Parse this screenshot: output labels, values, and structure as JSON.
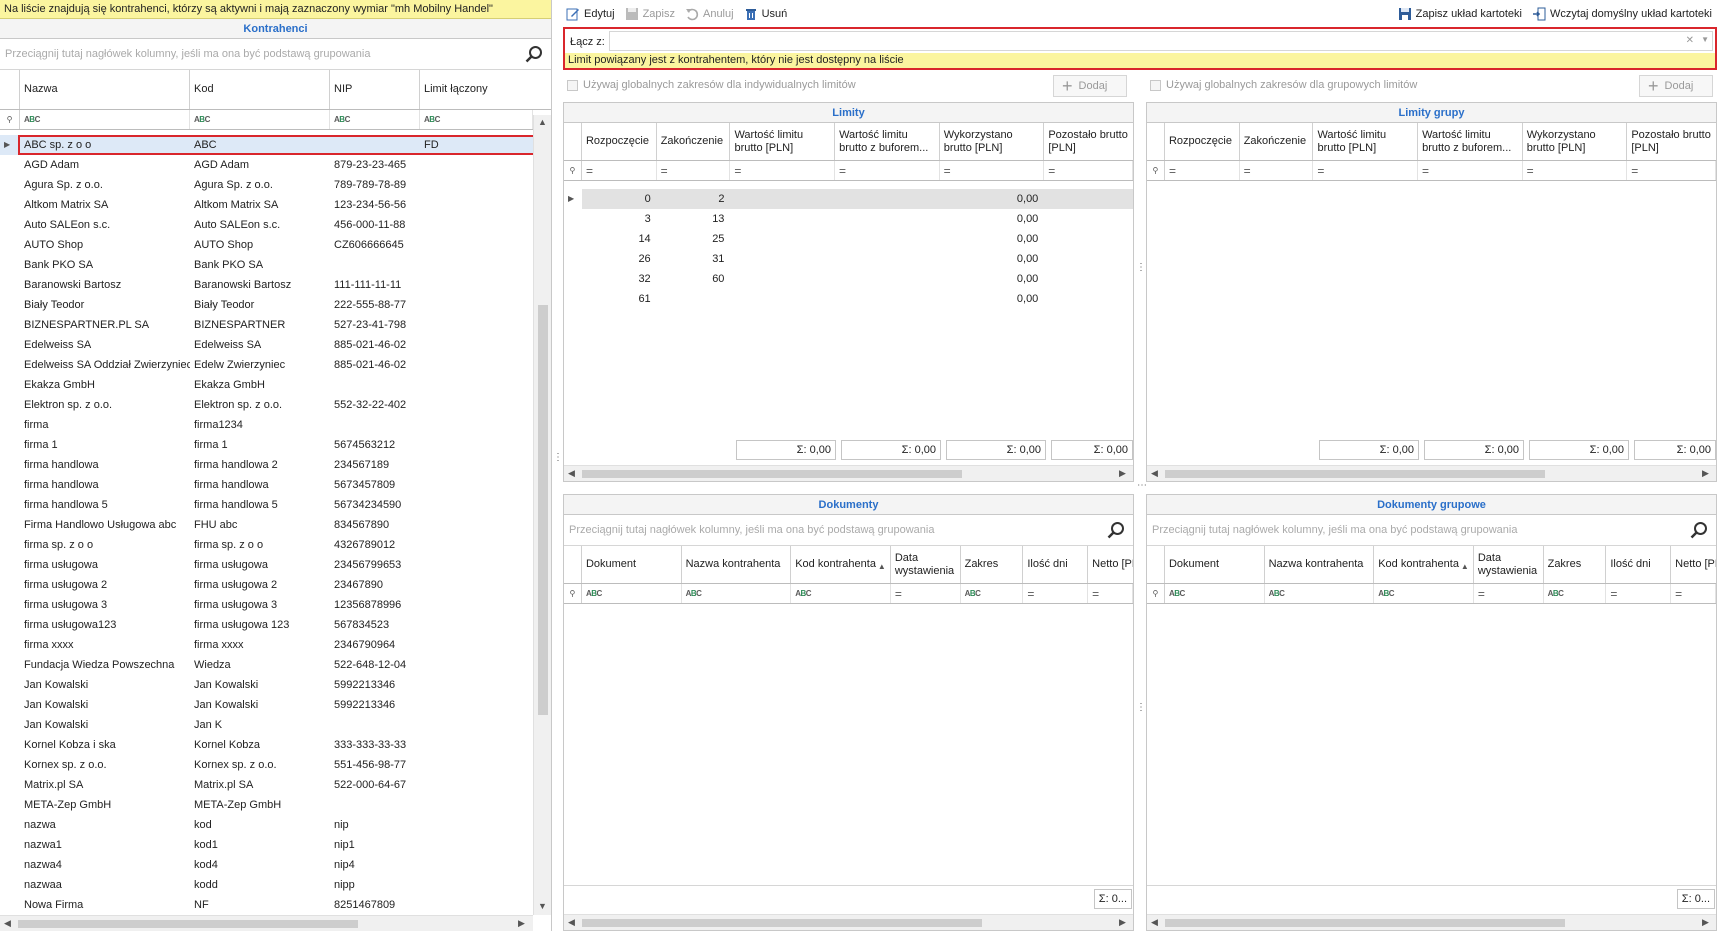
{
  "left": {
    "notice": "Na liście znajdują się kontrahenci, którzy są aktywni i mają zaznaczony wymiar \"mh Mobilny Handel\"",
    "title": "Kontrahenci",
    "group_placeholder": "Przeciągnij tutaj nagłówek kolumny, jeśli ma ona być podstawą grupowania",
    "columns": [
      "Nazwa",
      "Kod",
      "NIP",
      "Limit łączony"
    ],
    "rows": [
      [
        "ABC sp. z o o",
        "ABC",
        "",
        "FD"
      ],
      [
        "AGD Adam",
        "AGD Adam",
        "879-23-23-465",
        ""
      ],
      [
        "Agura Sp. z o.o.",
        "Agura Sp. z o.o.",
        "789-789-78-89",
        ""
      ],
      [
        "Altkom Matrix SA",
        "Altkom Matrix SA",
        "123-234-56-56",
        ""
      ],
      [
        "Auto SALEon s.c.",
        "Auto SALEon s.c.",
        "456-000-11-88",
        ""
      ],
      [
        "AUTO Shop",
        "AUTO Shop",
        "CZ606666645",
        ""
      ],
      [
        "Bank PKO SA",
        "Bank PKO SA",
        "",
        ""
      ],
      [
        "Baranowski Bartosz",
        "Baranowski Bartosz",
        "111-111-11-11",
        ""
      ],
      [
        "Biały Teodor",
        "Biały Teodor",
        "222-555-88-77",
        ""
      ],
      [
        "BIZNESPARTNER.PL SA",
        "BIZNESPARTNER",
        "527-23-41-798",
        ""
      ],
      [
        "Edelweiss SA",
        "Edelweiss SA",
        "885-021-46-02",
        ""
      ],
      [
        "Edelweiss SA Oddział Zwierzyniec",
        "Edelw Zwierzyniec",
        "885-021-46-02",
        ""
      ],
      [
        "Ekakza GmbH",
        "Ekakza GmbH",
        "",
        ""
      ],
      [
        "Elektron sp. z o.o.",
        "Elektron sp. z o.o.",
        "552-32-22-402",
        ""
      ],
      [
        "firma",
        "firma1234",
        "",
        ""
      ],
      [
        "firma 1",
        "firma 1",
        "5674563212",
        ""
      ],
      [
        "firma handlowa",
        "firma handlowa 2",
        "234567189",
        ""
      ],
      [
        "firma handlowa",
        "firma handlowa",
        "5673457809",
        ""
      ],
      [
        "firma handlowa 5",
        "firma handlowa 5",
        "56734234590",
        ""
      ],
      [
        "Firma Handlowo Usługowa abc",
        "FHU abc",
        "834567890",
        ""
      ],
      [
        "firma sp. z o o",
        "firma sp. z o o",
        "4326789012",
        ""
      ],
      [
        "firma usługowa",
        "firma usługowa",
        "23456799653",
        ""
      ],
      [
        "firma usługowa 2",
        "firma usługowa 2",
        "23467890",
        ""
      ],
      [
        "firma usługowa 3",
        "firma usługowa 3",
        "12356878996",
        ""
      ],
      [
        "firma usługowa123",
        "firma usługowa 123",
        "567834523",
        ""
      ],
      [
        "firma xxxx",
        "firma xxxx",
        "2346790964",
        ""
      ],
      [
        "Fundacja Wiedza Powszechna",
        "Wiedza",
        "522-648-12-04",
        ""
      ],
      [
        "Jan Kowalski",
        "Jan Kowalski",
        "5992213346",
        ""
      ],
      [
        "Jan Kowalski",
        "Jan Kowalski",
        "5992213346",
        ""
      ],
      [
        "Jan Kowalski",
        "Jan K",
        "",
        ""
      ],
      [
        "Kornel Kobza i ska",
        "Kornel Kobza",
        "333-333-33-33",
        ""
      ],
      [
        "Kornex sp. z o.o.",
        "Kornex sp. z o.o.",
        "551-456-98-77",
        ""
      ],
      [
        "Matrix.pl SA",
        "Matrix.pl SA",
        "522-000-64-67",
        ""
      ],
      [
        "META-Zep GmbH",
        "META-Zep GmbH",
        "",
        ""
      ],
      [
        "nazwa",
        "kod",
        "nip",
        ""
      ],
      [
        "nazwa1",
        "kod1",
        "nip1",
        ""
      ],
      [
        "nazwa4",
        "kod4",
        "nip4",
        ""
      ],
      [
        "nazwaa",
        "kodd",
        "nipp",
        ""
      ],
      [
        "Nowa Firma",
        "NF",
        "8251467809",
        ""
      ]
    ]
  },
  "toolbar": {
    "edit": "Edytuj",
    "save": "Zapisz",
    "cancel": "Anuluj",
    "delete": "Usuń",
    "save_layout": "Zapisz układ kartoteki",
    "load_layout": "Wczytaj domyślny układ kartoteki"
  },
  "link": {
    "label": "Łącz z:",
    "value": "",
    "warning": "Limit powiązany jest z kontrahentem, który nie jest dostępny na liście"
  },
  "limits": {
    "use_global_label": "Używaj globalnych zakresów dla indywidualnych limitów",
    "add_label": "Dodaj",
    "title": "Limity",
    "columns": [
      "Rozpoczęcie",
      "Zakończenie",
      "Wartość limitu brutto [PLN]",
      "Wartość limitu brutto z buforem...",
      "Wykorzystano brutto [PLN]",
      "Pozostało brutto [PLN]"
    ],
    "rows": [
      [
        "0",
        "2",
        "",
        "",
        "0,00",
        ""
      ],
      [
        "3",
        "13",
        "",
        "",
        "0,00",
        ""
      ],
      [
        "14",
        "25",
        "",
        "",
        "0,00",
        ""
      ],
      [
        "26",
        "31",
        "",
        "",
        "0,00",
        ""
      ],
      [
        "32",
        "60",
        "",
        "",
        "0,00",
        ""
      ],
      [
        "61",
        "",
        "",
        "",
        "0,00",
        ""
      ]
    ],
    "sums": [
      "Σ: 0,00",
      "Σ: 0,00",
      "Σ: 0,00",
      "Σ: 0,00"
    ]
  },
  "group_limits": {
    "use_global_label": "Używaj globalnych zakresów dla grupowych limitów",
    "add_label": "Dodaj",
    "title": "Limity grupy",
    "columns": [
      "Rozpoczęcie",
      "Zakończenie",
      "Wartość limitu brutto [PLN]",
      "Wartość limitu brutto z buforem...",
      "Wykorzystano brutto [PLN]",
      "Pozostało brutto [PLN]"
    ],
    "sums": [
      "Σ: 0,00",
      "Σ: 0,00",
      "Σ: 0,00",
      "Σ: 0,00"
    ]
  },
  "documents": {
    "title": "Dokumenty",
    "group_placeholder": "Przeciągnij tutaj nagłówek kolumny, jeśli ma ona być podstawą grupowania",
    "columns": [
      "Dokument",
      "Nazwa kontrahenta",
      "Kod kontrahenta",
      "Data wystawienia",
      "Zakres",
      "Ilość dni",
      "Netto [PLN]"
    ],
    "sum": "Σ: 0..."
  },
  "group_documents": {
    "title": "Dokumenty grupowe",
    "group_placeholder": "Przeciągnij tutaj nagłówek kolumny, jeśli ma ona być podstawą grupowania",
    "columns": [
      "Dokument",
      "Nazwa kontrahenta",
      "Kod kontrahenta",
      "Data wystawienia",
      "Zakres",
      "Ilość dni",
      "Netto [PLN]"
    ],
    "sum": "Σ: 0..."
  },
  "colors": {
    "accent": "#2a6fc9",
    "notice_bg": "#fbf59f",
    "highlight_border": "#d9262c"
  }
}
